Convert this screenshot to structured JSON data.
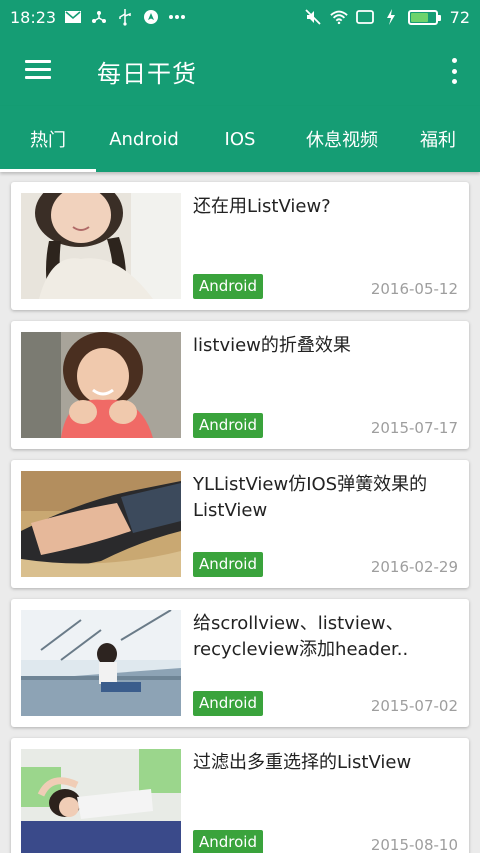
{
  "status_bar": {
    "time": "18:23",
    "left_icons": [
      "mail-icon",
      "share-icon",
      "usb-icon",
      "location-icon",
      "more-dots-icon"
    ],
    "right_icons": [
      "mute-icon",
      "wifi-icon",
      "cast-icon",
      "charging-icon"
    ],
    "battery_level": 72,
    "battery_text": "72"
  },
  "app_bar": {
    "title": "每日干货",
    "menu_icon": "menu-icon",
    "overflow_icon": "more-vert-icon"
  },
  "tabs": [
    {
      "label": "热门",
      "selected": true
    },
    {
      "label": "Android",
      "selected": false
    },
    {
      "label": "IOS",
      "selected": false
    },
    {
      "label": "休息视频",
      "selected": false
    },
    {
      "label": "福利",
      "selected": false
    }
  ],
  "articles": [
    {
      "title": "还在用ListView?",
      "tag": "Android",
      "date": "2016-05-12"
    },
    {
      "title": "listview的折叠效果",
      "tag": "Android",
      "date": "2015-07-17"
    },
    {
      "title": "YLListView仿IOS弹簧效果的ListView",
      "tag": "Android",
      "date": "2016-02-29"
    },
    {
      "title": "给scrollview、listview、recycleview添加header..",
      "tag": "Android",
      "date": "2015-07-02"
    },
    {
      "title": "过滤出多重选择的ListView",
      "tag": "Android",
      "date": "2015-08-10"
    }
  ],
  "colors": {
    "primary": "#159d74",
    "badge": "#3aa33c",
    "date_text": "#9e9e9e",
    "background": "#ebebeb"
  }
}
